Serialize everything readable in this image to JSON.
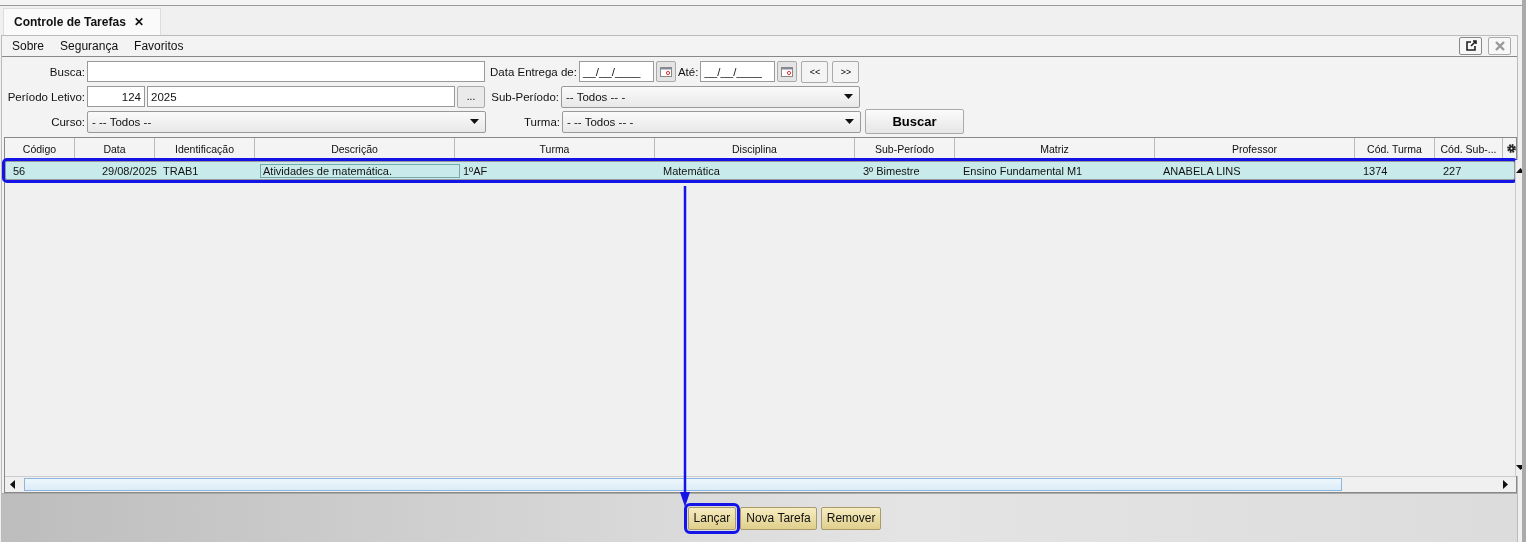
{
  "tab": {
    "title": "Controle de Tarefas",
    "close": "✕"
  },
  "menu": [
    "Sobre",
    "Segurança",
    "Favoritos"
  ],
  "filters": {
    "busca": {
      "label": "Busca:"
    },
    "data_entrega": {
      "label": "Data Entrega de:",
      "value": "__/__/____"
    },
    "ate": {
      "label": "Até:",
      "value": "__/__/____"
    },
    "prev": "<<",
    "next": ">>",
    "periodo": {
      "label": "Período Letivo:",
      "code": "124",
      "value": "2025",
      "button": "..."
    },
    "sub_periodo": {
      "label": "Sub-Período:",
      "value": "-- Todos -- -"
    },
    "curso": {
      "label": "Curso:",
      "value": "- -- Todos --"
    },
    "turma": {
      "label": "Turma:",
      "value": "- -- Todos -- -"
    },
    "search_button": "Buscar"
  },
  "table": {
    "columns": [
      "Código",
      "Data",
      "Identificação",
      "Descrição",
      "Turma",
      "Disciplina",
      "Sub-Período",
      "Matriz",
      "Professor",
      "Cód. Turma",
      "Cód. Sub-..."
    ],
    "rows": [
      {
        "selected": true,
        "highlighted": true,
        "cells": [
          "56",
          "29/08/2025",
          "TRAB1",
          "Atividades de matemática.",
          "1ºAF",
          "Matemática",
          "3º Bimestre",
          "Ensino Fundamental M1",
          "ANABELA LINS",
          "1374",
          "227"
        ]
      }
    ]
  },
  "buttons": [
    {
      "label": "Lançar",
      "highlighted": true
    },
    {
      "label": "Nova Tarefa",
      "highlighted": false
    },
    {
      "label": "Remover",
      "highlighted": false
    }
  ],
  "annotation_arrow": true
}
